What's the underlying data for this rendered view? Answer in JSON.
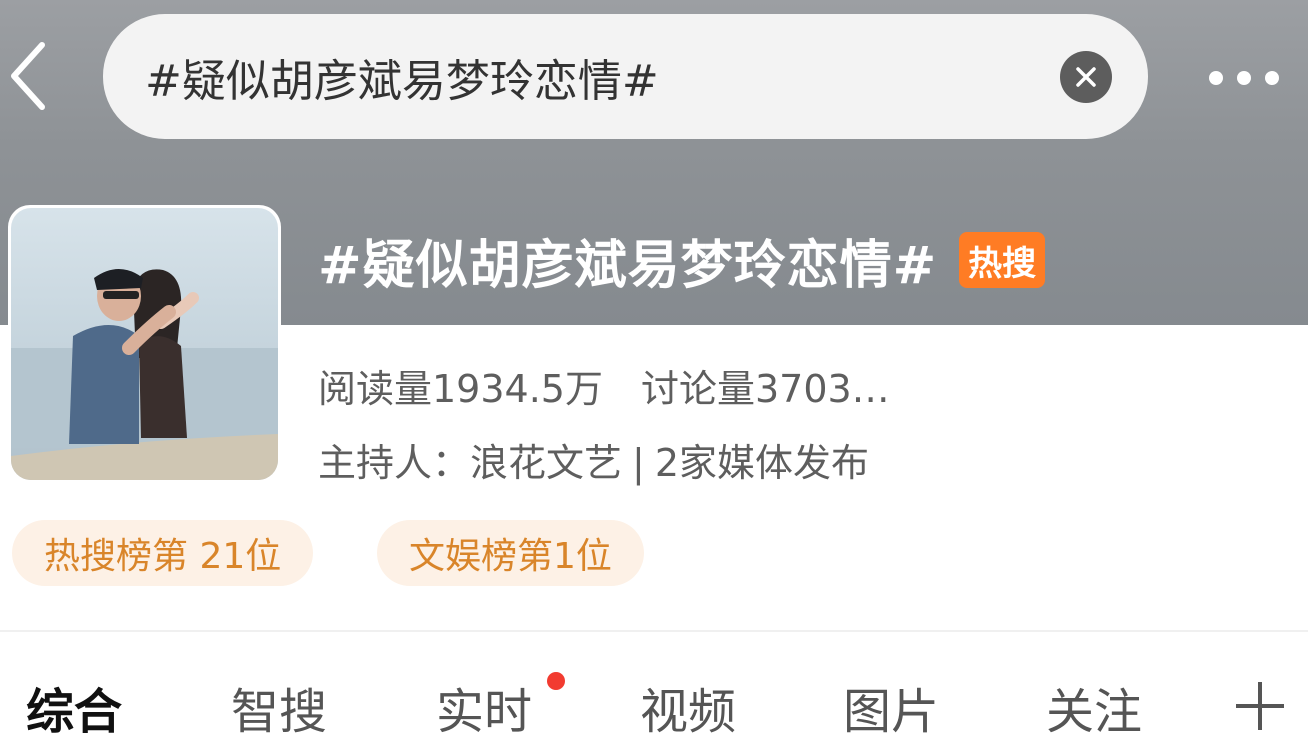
{
  "header": {
    "search_query": "#疑似胡彦斌易梦玲恋情#"
  },
  "topic": {
    "title": "#疑似胡彦斌易梦玲恋情#",
    "badge": "热搜",
    "reads": "阅读量1934.5万",
    "discussions": "讨论量3703…",
    "host_label": "主持人：",
    "host_name": "浪花文艺",
    "separator": "|",
    "media_count": "2家媒体发布",
    "ranks": [
      "热搜榜第 21位",
      "文娱榜第1位"
    ]
  },
  "tabs": [
    {
      "label": "综合",
      "active": true
    },
    {
      "label": "智搜"
    },
    {
      "label": "实时",
      "has_dot": true
    },
    {
      "label": "视频"
    },
    {
      "label": "图片"
    },
    {
      "label": "关注"
    }
  ],
  "colors": {
    "header_gray": "#8e9296",
    "badge_orange": "#ff7c24",
    "rank_text": "#d9852a",
    "rank_bg": "#fdf1e6",
    "notify_red": "#f23b30"
  }
}
